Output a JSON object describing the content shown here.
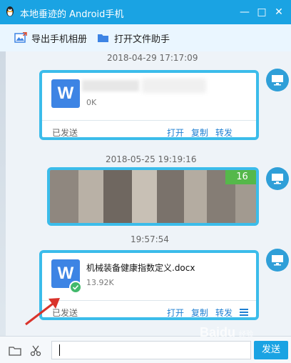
{
  "window": {
    "title": "本地垂迹的 Android手机",
    "minimize_label": "—",
    "maximize_label": "□",
    "close_label": "✕"
  },
  "toolbar": {
    "export_album_label": "导出手机相册",
    "open_file_helper_label": "打开文件助手"
  },
  "messages": [
    {
      "timestamp": "2018-04-29 17:17:09",
      "file_name": "",
      "file_size": "0K",
      "status": "已发送",
      "actions": [
        "打开",
        "复制",
        "转发"
      ]
    },
    {
      "timestamp": "2018-05-25 19:19:16",
      "image_count": "16"
    },
    {
      "timestamp": "19:57:54",
      "file_name": "机械装备健康指数定义.docx",
      "file_size": "13.92K",
      "status": "已发送",
      "actions": [
        "打开",
        "复制",
        "转发"
      ]
    }
  ],
  "input": {
    "value": ""
  },
  "send_label": "发送",
  "watermark": {
    "brand": "Baidu",
    "sub": "经验"
  },
  "icons": {
    "window": "qq-penguin-icon",
    "export": "photo-icon",
    "file_helper": "folder-icon",
    "file_type": "word-doc-icon",
    "device": "monitor-icon"
  },
  "colors": {
    "title_bar": "#1aa3e3",
    "bubble_border": "#3bbcea",
    "action_link": "#1e7fd2",
    "badge": "#55b84a"
  }
}
